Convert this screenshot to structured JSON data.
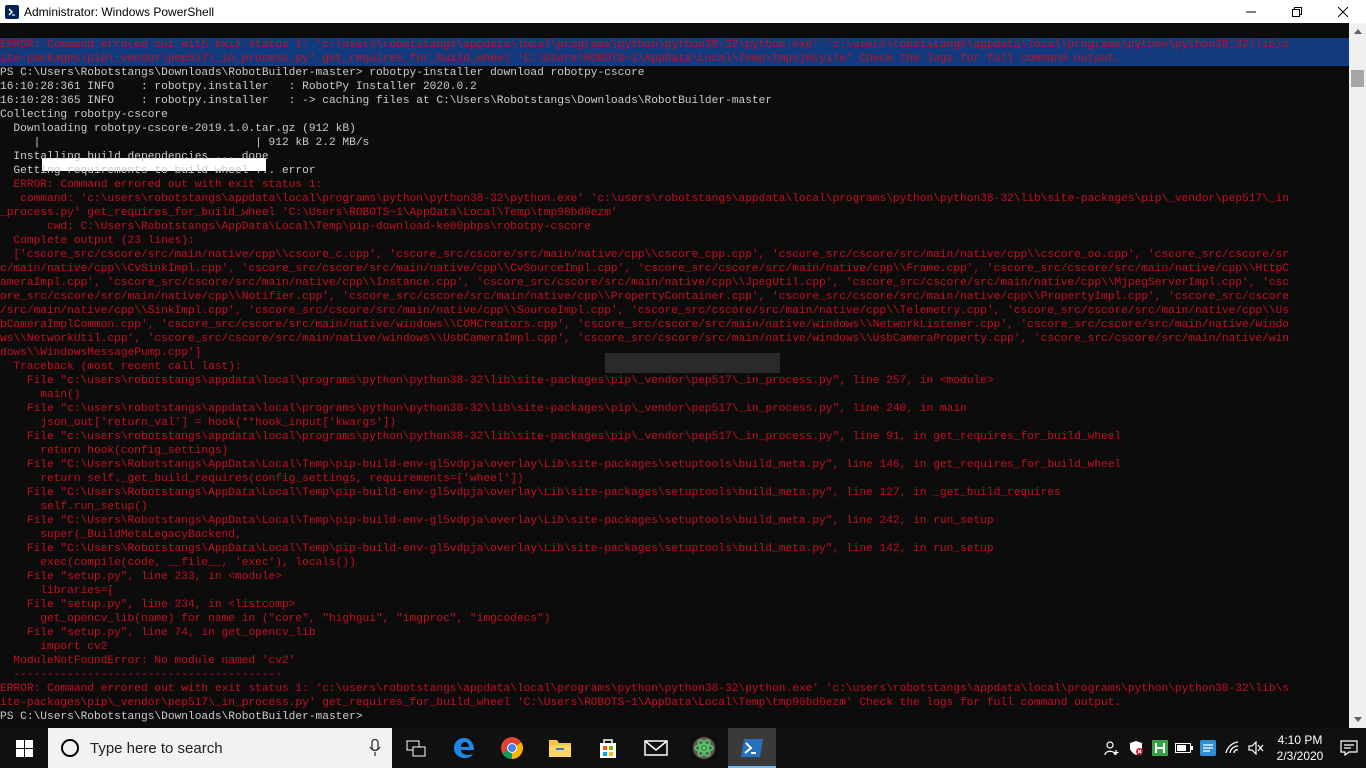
{
  "window": {
    "title": "Administrator: Windows PowerShell",
    "controls": [
      "minimize",
      "maximize",
      "close"
    ]
  },
  "console": {
    "lines": [
      {
        "text": "ERROR: Command errored out with exit status 1: 'c:\\users\\robotstangs\\appdata\\local\\programs\\python\\python38-32\\python.exe' 'c:\\users\\robotstangs\\appdata\\local\\programs\\python\\python38-32\\lib\\s",
        "color": "red",
        "selected": true
      },
      {
        "text": "ite-packages\\pip\\_vendor\\pep517\\_in_process.py' get_requires_for_build_wheel 'C:\\Users\\ROBOTS~1\\AppData\\Local\\Temp\\tmpsj0cyile' Check the logs for full command output.",
        "color": "red",
        "selected": true
      },
      {
        "text": "PS C:\\Users\\Robotstangs\\Downloads\\RobotBuilder-master> robotpy-installer download robotpy-cscore",
        "color": "white"
      },
      {
        "text": "16:10:28:361 INFO    : robotpy.installer   : RobotPy Installer 2020.0.2",
        "color": "white"
      },
      {
        "text": "16:10:28:365 INFO    : robotpy.installer   : -> caching files at C:\\Users\\Robotstangs\\Downloads\\RobotBuilder-master",
        "color": "white"
      },
      {
        "text": "Collecting robotpy-cscore",
        "color": "white"
      },
      {
        "text": "  Downloading robotpy-cscore-2019.1.0.tar.gz (912 kB)",
        "color": "white"
      },
      {
        "text": "     |                                | 912 kB 2.2 MB/s",
        "color": "white"
      },
      {
        "text": "  Installing build dependencies ... done",
        "color": "white"
      },
      {
        "text": "  Getting requirements to build wheel ... error",
        "color": "white"
      },
      {
        "text": "  ERROR: Command errored out with exit status 1:",
        "color": "red"
      },
      {
        "text": "   command: 'c:\\users\\robotstangs\\appdata\\local\\programs\\python\\python38-32\\python.exe' 'c:\\users\\robotstangs\\appdata\\local\\programs\\python\\python38-32\\lib\\site-packages\\pip\\_vendor\\pep517\\_in",
        "color": "red"
      },
      {
        "text": "_process.py' get_requires_for_build_wheel 'C:\\Users\\ROBOTS~1\\AppData\\Local\\Temp\\tmp90bd0ezm'",
        "color": "red"
      },
      {
        "text": "       cwd: C:\\Users\\Robotstangs\\AppData\\Local\\Temp\\pip-download-ke00pbps\\robotpy-cscore",
        "color": "red"
      },
      {
        "text": "  Complete output (23 lines):",
        "color": "red"
      },
      {
        "text": "  ['cscore_src/cscore/src/main/native/cpp\\\\cscore_c.cpp', 'cscore_src/cscore/src/main/native/cpp\\\\cscore_cpp.cpp', 'cscore_src/cscore/src/main/native/cpp\\\\cscore_oo.cpp', 'cscore_src/cscore/sr",
        "color": "red"
      },
      {
        "text": "c/main/native/cpp\\\\CvSinkImpl.cpp', 'cscore_src/cscore/src/main/native/cpp\\\\CvSourceImpl.cpp', 'cscore_src/cscore/src/main/native/cpp\\\\Frame.cpp', 'cscore_src/cscore/src/main/native/cpp\\\\HttpC",
        "color": "red"
      },
      {
        "text": "ameraImpl.cpp', 'cscore_src/cscore/src/main/native/cpp\\\\Instance.cpp', 'cscore_src/cscore/src/main/native/cpp\\\\JpegUtil.cpp', 'cscore_src/cscore/src/main/native/cpp\\\\MjpegServerImpl.cpp', 'csc",
        "color": "red"
      },
      {
        "text": "ore_src/cscore/src/main/native/cpp\\\\Notifier.cpp', 'cscore_src/cscore/src/main/native/cpp\\\\PropertyContainer.cpp', 'cscore_src/cscore/src/main/native/cpp\\\\PropertyImpl.cpp', 'cscore_src/cscore",
        "color": "red"
      },
      {
        "text": "/src/main/native/cpp\\\\SinkImpl.cpp', 'cscore_src/cscore/src/main/native/cpp\\\\SourceImpl.cpp', 'cscore_src/cscore/src/main/native/cpp\\\\Telemetry.cpp', 'cscore_src/cscore/src/main/native/cpp\\\\Us",
        "color": "red"
      },
      {
        "text": "bCameraImplCommon.cpp', 'cscore_src/cscore/src/main/native/windows\\\\COMCreators.cpp', 'cscore_src/cscore/src/main/native/windows\\\\NetworkListener.cpp', 'cscore_src/cscore/src/main/native/windo",
        "color": "red"
      },
      {
        "text": "ws\\\\NetworkUtil.cpp', 'cscore_src/cscore/src/main/native/windows\\\\UsbCameraImpl.cpp', 'cscore_src/cscore/src/main/native/windows\\\\UsbCameraProperty.cpp', 'cscore_src/cscore/src/main/native/win",
        "color": "red"
      },
      {
        "text": "dows\\\\WindowsMessagePump.cpp']",
        "color": "red"
      },
      {
        "text": "  Traceback (most recent call last):",
        "color": "red"
      },
      {
        "text": "    File \"c:\\users\\robotstangs\\appdata\\local\\programs\\python\\python38-32\\lib\\site-packages\\pip\\_vendor\\pep517\\_in_process.py\", line 257, in <module>",
        "color": "red"
      },
      {
        "text": "      main()",
        "color": "red"
      },
      {
        "text": "    File \"c:\\users\\robotstangs\\appdata\\local\\programs\\python\\python38-32\\lib\\site-packages\\pip\\_vendor\\pep517\\_in_process.py\", line 240, in main",
        "color": "red"
      },
      {
        "text": "      json_out['return_val'] = hook(**hook_input['kwargs'])",
        "color": "red"
      },
      {
        "text": "    File \"c:\\users\\robotstangs\\appdata\\local\\programs\\python\\python38-32\\lib\\site-packages\\pip\\_vendor\\pep517\\_in_process.py\", line 91, in get_requires_for_build_wheel",
        "color": "red"
      },
      {
        "text": "      return hook(config_settings)",
        "color": "red"
      },
      {
        "text": "    File \"C:\\Users\\Robotstangs\\AppData\\Local\\Temp\\pip-build-env-gl5vdpja\\overlay\\Lib\\site-packages\\setuptools\\build_meta.py\", line 146, in get_requires_for_build_wheel",
        "color": "red"
      },
      {
        "text": "      return self._get_build_requires(config_settings, requirements=['wheel'])",
        "color": "red"
      },
      {
        "text": "    File \"C:\\Users\\Robotstangs\\AppData\\Local\\Temp\\pip-build-env-gl5vdpja\\overlay\\Lib\\site-packages\\setuptools\\build_meta.py\", line 127, in _get_build_requires",
        "color": "red"
      },
      {
        "text": "      self.run_setup()",
        "color": "red"
      },
      {
        "text": "    File \"C:\\Users\\Robotstangs\\AppData\\Local\\Temp\\pip-build-env-gl5vdpja\\overlay\\Lib\\site-packages\\setuptools\\build_meta.py\", line 242, in run_setup",
        "color": "red"
      },
      {
        "text": "      super(_BuildMetaLegacyBackend,",
        "color": "red"
      },
      {
        "text": "    File \"C:\\Users\\Robotstangs\\AppData\\Local\\Temp\\pip-build-env-gl5vdpja\\overlay\\Lib\\site-packages\\setuptools\\build_meta.py\", line 142, in run_setup",
        "color": "red"
      },
      {
        "text": "      exec(compile(code, __file__, 'exec'), locals())",
        "color": "red"
      },
      {
        "text": "    File \"setup.py\", line 233, in <module>",
        "color": "red"
      },
      {
        "text": "      libraries=[",
        "color": "red"
      },
      {
        "text": "    File \"setup.py\", line 234, in <listcomp>",
        "color": "red"
      },
      {
        "text": "      get_opencv_lib(name) for name in (\"core\", \"highgui\", \"imgproc\", \"imgcodecs\")",
        "color": "red"
      },
      {
        "text": "    File \"setup.py\", line 74, in get_opencv_lib",
        "color": "red"
      },
      {
        "text": "      import cv2",
        "color": "red"
      },
      {
        "text": "  ModuleNotFoundError: No module named 'cv2'",
        "color": "red"
      },
      {
        "text": "  ----------------------------------------",
        "color": "red"
      },
      {
        "text": "ERROR: Command errored out with exit status 1: 'c:\\users\\robotstangs\\appdata\\local\\programs\\python\\python38-32\\python.exe' 'c:\\users\\robotstangs\\appdata\\local\\programs\\python\\python38-32\\lib\\s",
        "color": "red"
      },
      {
        "text": "ite-packages\\pip\\_vendor\\pep517\\_in_process.py' get_requires_for_build_wheel 'C:\\Users\\ROBOTS~1\\AppData\\Local\\Temp\\tmp90bd0ezm' Check the logs for full command output.",
        "color": "red"
      },
      {
        "text": "PS C:\\Users\\Robotstangs\\Downloads\\RobotBuilder-master>",
        "color": "white"
      }
    ],
    "download_progress": 1.0
  },
  "colors": {
    "console_bg": "#0c0c0c",
    "text_white": "#cccccc",
    "text_red": "#c50f1f",
    "selection": "#133a7c",
    "taskbar_bg": "#101010",
    "accent": "#76b9ed"
  },
  "taskbar": {
    "search_placeholder": "Type here to search",
    "pinned": [
      {
        "name": "task-view",
        "icon": "task-view-icon"
      },
      {
        "name": "edge",
        "icon": "edge-icon"
      },
      {
        "name": "chrome",
        "icon": "chrome-icon"
      },
      {
        "name": "file-explorer",
        "icon": "folder-icon"
      },
      {
        "name": "store",
        "icon": "store-icon"
      },
      {
        "name": "mail",
        "icon": "mail-icon"
      },
      {
        "name": "atom",
        "icon": "atom-icon"
      },
      {
        "name": "powershell",
        "icon": "powershell-icon",
        "active": true
      }
    ],
    "clock": {
      "time": "4:10 PM",
      "date": "2/3/2020"
    }
  }
}
